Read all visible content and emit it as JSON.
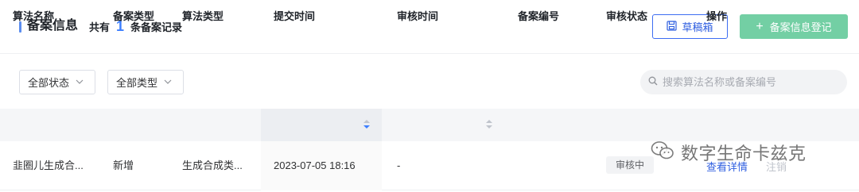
{
  "header": {
    "title": "备案信息",
    "count_prefix": "共有",
    "count": "1",
    "count_suffix": "条备案记录",
    "draft_label": "草稿箱",
    "register_label": "备案信息登记"
  },
  "filters": {
    "status": "全部状态",
    "type": "全部类型"
  },
  "search": {
    "placeholder": "搜索算法名称或备案编号"
  },
  "table": {
    "columns": [
      "算法名称",
      "备案类型",
      "算法类型",
      "提交时间",
      "审核时间",
      "备案编号",
      "审核状态",
      "操作"
    ],
    "rows": [
      {
        "name": "韭圈儿生成合...",
        "record_type": "新增",
        "algo_type": "生成合成类...",
        "submit_time": "2023-07-05 18:16",
        "review_time": "-",
        "record_no": "",
        "status": "审核中",
        "action_view": "查看详情",
        "action_cancel": "注销"
      }
    ]
  },
  "watermark": {
    "text": "数字生命卡兹克"
  },
  "colors": {
    "accent": "#3d7fff",
    "primary_button": "#73cfa4",
    "link": "#2f5fe0"
  }
}
